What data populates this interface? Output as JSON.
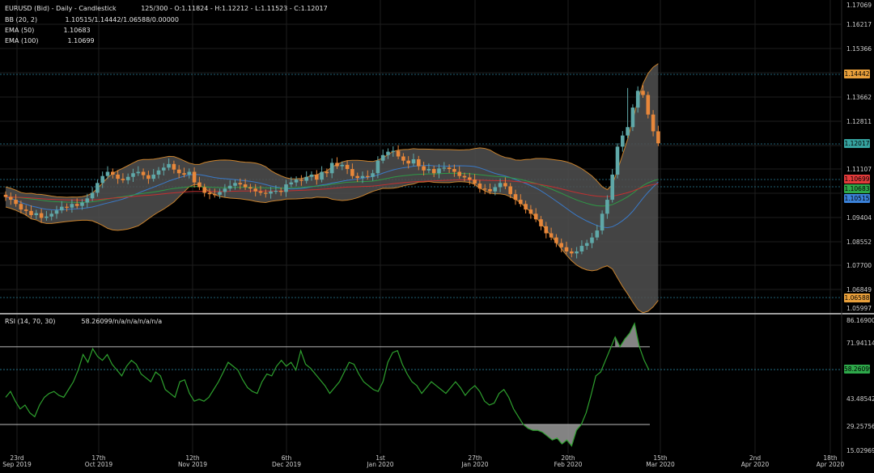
{
  "header": {
    "title": "EURUSD (Bid) - Daily - Candlestick",
    "ohlc": "125/300 - O:1.11824 - H:1.12212 - L:1.11523 - C:1.12017",
    "bb_label": "BB (20, 2)",
    "bb_value": "1.10515/1.14442/1.06588/0.00000",
    "ema50_label": "EMA (50)",
    "ema50_value": "1.10683",
    "ema100_label": "EMA (100)",
    "ema100_value": "1.10699"
  },
  "rsi_header": {
    "label": "RSI (14, 70, 30)",
    "value": "58.26099/n/a/n/a/n/a/n/a"
  },
  "price_axis": {
    "labels": [
      "1.17069",
      "1.16217",
      "1.15366",
      "1.13662",
      "1.12811",
      "1.11107",
      "1.09404",
      "1.08552",
      "1.07700",
      "1.06849",
      "1.05997"
    ],
    "tags": [
      {
        "text": "1.14442",
        "color": "#e9a03b"
      },
      {
        "text": "1.12017",
        "color": "#36a3a0"
      },
      {
        "text": "1.10699",
        "color": "#e23b3b"
      },
      {
        "text": "1.10683",
        "color": "#2ea84a"
      },
      {
        "text": "1.10515",
        "color": "#3b82d9"
      },
      {
        "text": "1.06588",
        "color": "#e9a03b"
      }
    ]
  },
  "rsi_axis": {
    "labels": [
      "86.16900",
      "71.94114",
      "43.48542",
      "29.25756",
      "15.02969"
    ],
    "tag": {
      "text": "58.26099",
      "color": "#2ea84a"
    }
  },
  "time_axis": {
    "labels": [
      {
        "day": "23rd",
        "month": "Sep 2019"
      },
      {
        "day": "17th",
        "month": "Oct 2019"
      },
      {
        "day": "12th",
        "month": "Nov 2019"
      },
      {
        "day": "6th",
        "month": "Dec 2019"
      },
      {
        "day": "1st",
        "month": "Jan 2020"
      },
      {
        "day": "27th",
        "month": "Jan 2020"
      },
      {
        "day": "20th",
        "month": "Feb 2020"
      },
      {
        "day": "15th",
        "month": "Mar 2020"
      },
      {
        "day": "2nd",
        "month": "Apr 2020"
      },
      {
        "day": "18th",
        "month": "Apr 2020"
      }
    ]
  },
  "colors": {
    "up": "#5fa8a8",
    "down": "#e8873a",
    "band_fill": "#505050",
    "band_line": "#c8822e",
    "ema50": "#2e9a46",
    "ema100": "#c43030",
    "mid": "#3a7ac8",
    "rsi": "#2ea02e"
  },
  "chart_data": [
    {
      "type": "candlestick",
      "title": "EURUSD (Bid) - Daily - Candlestick",
      "ylim": [
        1.0595,
        1.1715
      ],
      "close": [
        1.101,
        1.1,
        1.0985,
        1.0965,
        1.096,
        1.0945,
        1.0952,
        1.0935,
        1.094,
        1.095,
        1.0962,
        1.0975,
        1.0972,
        1.0985,
        1.0978,
        1.099,
        1.1005,
        1.1025,
        1.106,
        1.1085,
        1.11,
        1.109,
        1.1075,
        1.107,
        1.1082,
        1.1095,
        1.11,
        1.1088,
        1.1075,
        1.109,
        1.1105,
        1.1115,
        1.1128,
        1.1108,
        1.1095,
        1.109,
        1.11,
        1.1062,
        1.1045,
        1.1025,
        1.102,
        1.1018,
        1.1028,
        1.104,
        1.105,
        1.106,
        1.1055,
        1.1045,
        1.104,
        1.103,
        1.1025,
        1.1022,
        1.103,
        1.1032,
        1.1028,
        1.1055,
        1.1062,
        1.1072,
        1.1068,
        1.1082,
        1.109,
        1.1072,
        1.11,
        1.1095,
        1.1132,
        1.112,
        1.1125,
        1.111,
        1.1085,
        1.1078,
        1.1085,
        1.1082,
        1.1095,
        1.114,
        1.116,
        1.1172,
        1.1175,
        1.1155,
        1.114,
        1.113,
        1.1145,
        1.112,
        1.1105,
        1.111,
        1.1095,
        1.1112,
        1.1115,
        1.111,
        1.11,
        1.1085,
        1.108,
        1.1072,
        1.1058,
        1.104,
        1.1038,
        1.103,
        1.1045,
        1.106,
        1.1048,
        1.102,
        1.1,
        1.0985,
        1.0965,
        1.095,
        1.093,
        1.0905,
        1.088,
        1.0865,
        1.0845,
        1.083,
        1.0815,
        1.0808,
        1.0815,
        1.0835,
        1.0845,
        1.0865,
        1.089,
        1.095,
        1.1,
        1.109,
        1.119,
        1.123,
        1.126,
        1.133,
        1.139,
        1.1375,
        1.1305,
        1.1245,
        1.1202
      ]
    },
    {
      "type": "line",
      "title": "RSI (14, 70, 30)",
      "ylim": [
        15.02969,
        86.169
      ],
      "levels": [
        70,
        30
      ],
      "values": [
        44,
        47,
        42,
        38,
        40,
        36,
        34,
        40,
        44,
        46,
        47,
        45,
        44,
        48,
        52,
        58,
        66,
        62,
        69,
        65,
        63,
        66,
        61,
        58,
        55,
        60,
        63,
        61,
        56,
        54,
        52,
        57,
        55,
        48,
        46,
        44,
        52,
        53,
        46,
        42,
        43,
        42,
        44,
        48,
        52,
        57,
        62,
        60,
        58,
        53,
        49,
        47,
        46,
        52,
        56,
        55,
        60,
        63,
        60,
        62,
        58,
        68,
        61,
        59,
        56,
        53,
        50,
        46,
        49,
        52,
        57,
        62,
        61,
        56,
        52,
        50,
        48,
        47,
        52,
        62,
        67,
        68,
        61,
        56,
        52,
        50,
        46,
        49,
        52,
        50,
        48,
        46,
        49,
        52,
        49,
        45,
        48,
        50,
        47,
        42,
        40,
        41,
        46,
        48,
        44,
        38,
        34,
        30,
        28,
        27,
        27,
        26,
        24,
        22,
        23,
        20,
        22,
        19,
        27,
        30,
        36,
        45,
        55,
        57,
        63,
        69,
        75,
        70,
        74,
        77,
        82,
        70,
        63,
        58
      ]
    }
  ]
}
